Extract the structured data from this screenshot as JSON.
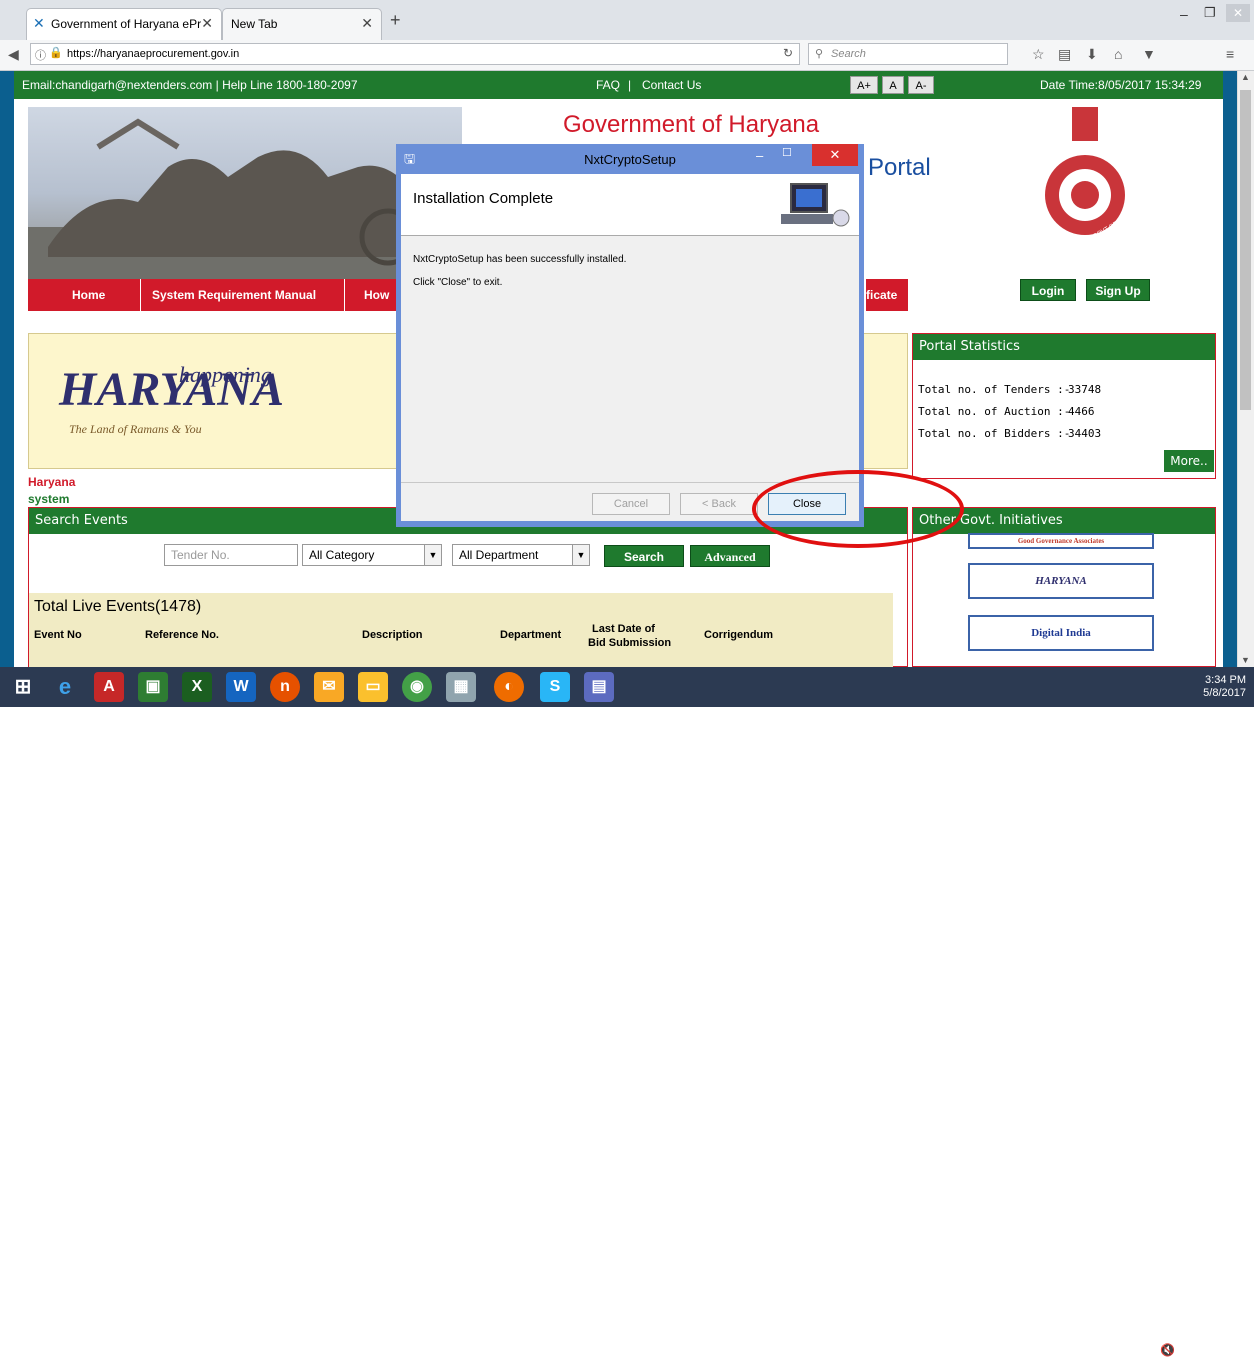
{
  "browser": {
    "tabs": [
      {
        "label": "Government of Haryana ePr",
        "active": true
      },
      {
        "label": "New Tab",
        "active": false
      }
    ],
    "new_tab_symbol": "+",
    "url": "https://haryanaeprocurement.gov.in",
    "search_placeholder": "Search",
    "window_controls": {
      "minimize": "–",
      "maximize": "❐",
      "close": "✕"
    }
  },
  "topbar": {
    "contact": "Email:chandigarh@nextenders.com  | Help Line 1800-180-2097",
    "faq": "FAQ",
    "separator": "|",
    "contact_us": "Contact Us",
    "font_sizes": [
      "A+",
      "A",
      "A-"
    ],
    "datetime": "Date Time:8/05/2017 15:34:29"
  },
  "header": {
    "title_fragment": "Government of Haryana",
    "portal_fragment": "Portal",
    "emblem_text": "GOVT OF HARYANA",
    "login": "Login",
    "signup": "Sign Up"
  },
  "menu": {
    "items": [
      "Home",
      "System Requirement Manual",
      "How"
    ],
    "cert_fragment": "ficate"
  },
  "banner": {
    "logo_text": "HARYANA",
    "tagline": "happening",
    "script": "The Land of Ramans & You",
    "caption1": "Haryana",
    "caption2": "system"
  },
  "portal_stats": {
    "title": "Portal Statistics",
    "rows": [
      {
        "label": "Total no. of Tenders :-",
        "value": "33748"
      },
      {
        "label": "Total no. of Auction :-",
        "value": "4466"
      },
      {
        "label": "Total no. of Bidders :-",
        "value": "34403"
      }
    ],
    "more": "More.."
  },
  "search_events": {
    "title": "Search Events",
    "tender_placeholder": "Tender No.",
    "category": "All Category",
    "department": "All Department",
    "search_btn": "Search",
    "advanced_btn": "Advanced",
    "live_title": "Total Live Events(1478)",
    "columns": [
      "Event No",
      "Reference No.",
      "Description",
      "Department",
      "Last Date of",
      "Bid Submission",
      "Corrigendum"
    ]
  },
  "other_initiatives": {
    "title": "Other Govt. Initiatives",
    "logos": [
      "Good Governance Associates",
      "HARYANA",
      "Digital India"
    ]
  },
  "dialog": {
    "title": "NxtCryptoSetup",
    "heading": "Installation Complete",
    "message1": "NxtCryptoSetup has been successfully installed.",
    "message2": "Click \"Close\" to exit.",
    "cancel": "Cancel",
    "back": "< Back",
    "close": "Close"
  },
  "taskbar": {
    "time": "3:34 PM",
    "date": "5/8/2017"
  },
  "colors": {
    "green": "#1f7a2e",
    "red": "#d11a2a",
    "dialog_frame": "#6a8fd8",
    "annotation": "#e01010"
  }
}
